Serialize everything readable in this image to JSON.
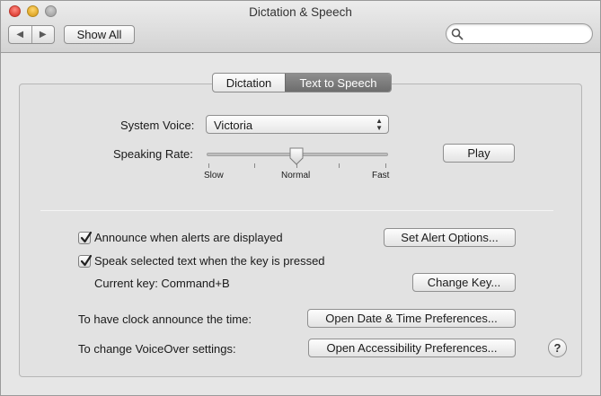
{
  "window": {
    "title": "Dictation & Speech"
  },
  "toolbar": {
    "back_glyph": "◀",
    "forward_glyph": "▶",
    "show_all_label": "Show All",
    "search_value": "",
    "search_icon": "search-icon"
  },
  "tabs": [
    {
      "label": "Dictation",
      "selected": false
    },
    {
      "label": "Text to Speech",
      "selected": true
    }
  ],
  "voice": {
    "label": "System Voice:",
    "selected": "Victoria"
  },
  "rate": {
    "label": "Speaking Rate:",
    "slow": "Slow",
    "normal": "Normal",
    "fast": "Fast",
    "value_fraction": 0.5
  },
  "play_label": "Play",
  "alerts": {
    "checkbox_label": "Announce when alerts are displayed",
    "checked": true,
    "button_label": "Set Alert Options..."
  },
  "speak_selected": {
    "checkbox_label": "Speak selected text when the key is pressed",
    "checked": true,
    "current_key_label": "Current key: Command+B",
    "button_label": "Change Key..."
  },
  "clock": {
    "label": "To have clock announce the time:",
    "button_label": "Open Date & Time Preferences..."
  },
  "voiceover": {
    "label": "To change VoiceOver settings:",
    "button_label": "Open Accessibility Preferences..."
  },
  "help_label": "?",
  "colors": {
    "selected_tab": "#7d7d7d",
    "window_bg": "#e6e6e6"
  }
}
